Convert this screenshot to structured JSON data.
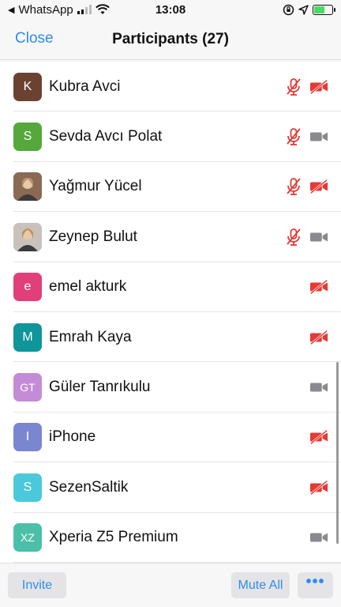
{
  "status_bar": {
    "back_app": "WhatsApp",
    "time": "13:08"
  },
  "header": {
    "close_label": "Close",
    "title": "Participants (27)"
  },
  "participants": [
    {
      "name": "Kubra Avci",
      "initials": "K",
      "avatar_color": "#6b4231",
      "mic_muted": true,
      "video_off": true
    },
    {
      "name": "Sevda Avcı Polat",
      "initials": "S",
      "avatar_color": "#56a83c",
      "mic_muted": true,
      "video_off": false
    },
    {
      "name": "Yağmur Yücel",
      "initials": "",
      "avatar_color": "#8a6a55",
      "photo": true,
      "mic_muted": true,
      "video_off": true
    },
    {
      "name": "Zeynep Bulut",
      "initials": "",
      "avatar_color": "#c9c2bc",
      "photo": true,
      "mic_muted": true,
      "video_off": false
    },
    {
      "name": "emel akturk",
      "initials": "e",
      "avatar_color": "#e13f7a",
      "mic_muted": false,
      "video_off": true
    },
    {
      "name": "Emrah Kaya",
      "initials": "M",
      "avatar_color": "#10959a",
      "mic_muted": false,
      "video_off": true
    },
    {
      "name": "Güler Tanrıkulu",
      "initials": "GT",
      "avatar_color": "#c48bd6",
      "mic_muted": false,
      "video_off": false
    },
    {
      "name": "iPhone",
      "initials": "I",
      "avatar_color": "#7b86d0",
      "mic_muted": false,
      "video_off": true
    },
    {
      "name": "SezenSaltik",
      "initials": "S",
      "avatar_color": "#4cc8dc",
      "mic_muted": false,
      "video_off": true
    },
    {
      "name": "Xperia Z5 Premium",
      "initials": "XZ",
      "avatar_color": "#4cbfa8",
      "mic_muted": false,
      "video_off": false
    }
  ],
  "bottom_bar": {
    "invite_label": "Invite",
    "mute_all_label": "Mute All",
    "more_label": "•••"
  },
  "colors": {
    "accent": "#2e8cf0",
    "muted_red": "#e53935",
    "neutral_icon": "#8a8a8e"
  },
  "icons": {
    "mic_muted": "mic-off-icon",
    "video_off": "video-off-icon",
    "video_on": "video-icon"
  }
}
